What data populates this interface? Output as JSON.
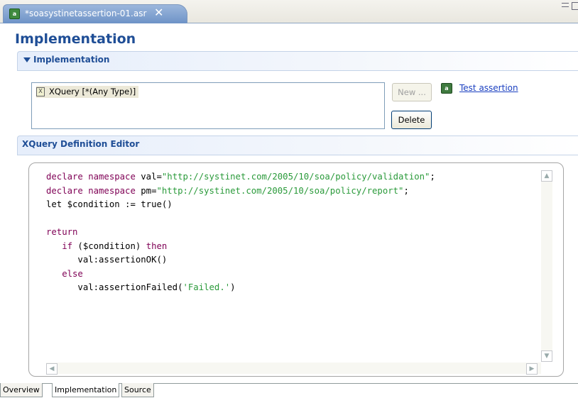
{
  "editor_tab": {
    "title": "*soasystinetassertion-01.asr",
    "close_glyph": "✕"
  },
  "page_title": "Implementation",
  "implementation_section": {
    "title": "Implementation",
    "list_items": [
      {
        "label": "XQuery [*(Any Type)]",
        "icon": "xquery-icon"
      }
    ],
    "new_button": "New ...",
    "delete_button": "Delete",
    "test_link": "Test assertion"
  },
  "editor_section": {
    "title": "XQuery Definition Editor"
  },
  "code": {
    "lines": [
      [
        {
          "t": "declare namespace",
          "c": "kw"
        },
        {
          "t": " val=",
          "c": ""
        },
        {
          "t": "\"http://systinet.com/2005/10/soa/policy/validation\"",
          "c": "str"
        },
        {
          "t": ";",
          "c": ""
        }
      ],
      [
        {
          "t": "declare namespace",
          "c": "kw"
        },
        {
          "t": " pm=",
          "c": ""
        },
        {
          "t": "\"http://systinet.com/2005/10/soa/policy/report\"",
          "c": "str"
        },
        {
          "t": ";",
          "c": ""
        }
      ],
      [
        {
          "t": "let $condition := true()",
          "c": ""
        }
      ],
      [],
      [
        {
          "t": "return",
          "c": "kw"
        }
      ],
      [
        {
          "t": "   ",
          "c": ""
        },
        {
          "t": "if",
          "c": "kw"
        },
        {
          "t": " ($condition) ",
          "c": ""
        },
        {
          "t": "then",
          "c": "kw"
        }
      ],
      [
        {
          "t": "      val:assertionOK()",
          "c": ""
        }
      ],
      [
        {
          "t": "   ",
          "c": ""
        },
        {
          "t": "else",
          "c": "kw"
        }
      ],
      [
        {
          "t": "      val:assertionFailed(",
          "c": ""
        },
        {
          "t": "'Failed.'",
          "c": "str"
        },
        {
          "t": ")",
          "c": ""
        }
      ]
    ]
  },
  "bottom_tabs": [
    "Overview",
    "Implementation",
    "Source"
  ],
  "colors": {
    "heading": "#1f4e96",
    "keyword": "#7f0055",
    "string": "#2a9a3a",
    "link": "#1a3fc0"
  }
}
